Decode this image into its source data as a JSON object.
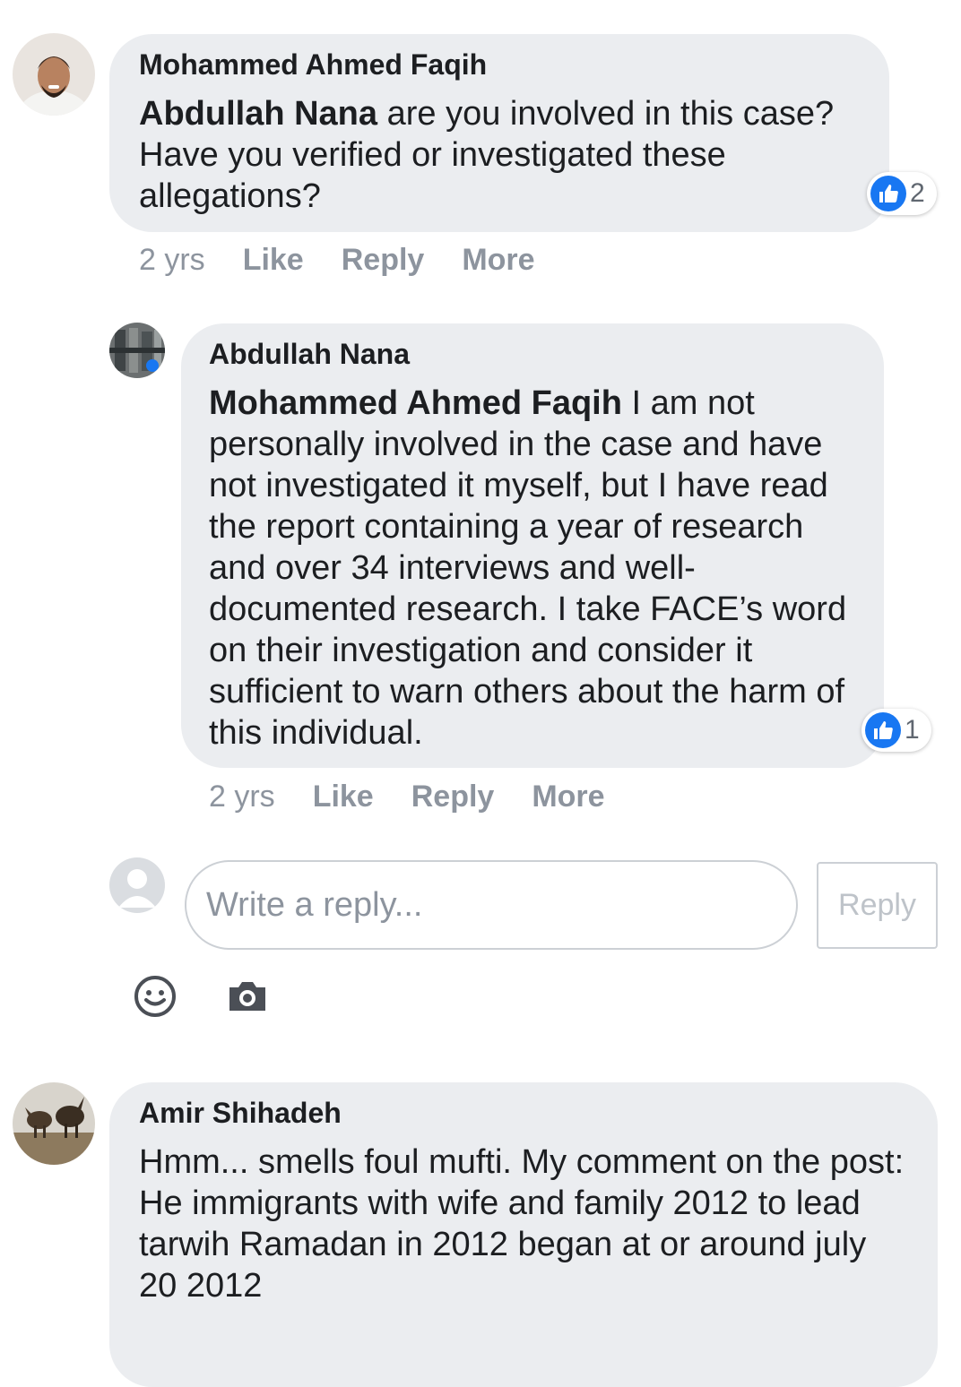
{
  "comments": [
    {
      "author": "Mohammed Ahmed Faqih",
      "mention": "Abdullah Nana",
      "text": " are you involved in this case? Have you verified or investigated these allegations?",
      "reaction_count": "2",
      "time": "2 yrs",
      "actions": [
        "Like",
        "Reply",
        "More"
      ]
    },
    {
      "author": "Abdullah Nana",
      "mention": "Mohammed Ahmed Faqih",
      "text": " I am not personally involved in the case and have not investigated it myself, but I have read the report containing a year of research and over 34 interviews and well-documented research. I take FACE’s word on their investigation and consider it sufficient to warn others about the harm of this individual.",
      "reaction_count": "1",
      "time": "2 yrs",
      "actions": [
        "Like",
        "Reply",
        "More"
      ]
    },
    {
      "author": "Amir Shihadeh",
      "text": "Hmm... smells foul mufti. My comment on the post: He immigrants with wife and family 2012 to lead tarwih Ramadan in 2012 began at or around july 20 2012"
    }
  ],
  "reply_box": {
    "placeholder": "Write a reply...",
    "button_label": "Reply"
  },
  "icons": {
    "reaction": "like-icon",
    "emoji": "smiley-icon",
    "camera": "camera-icon",
    "default_avatar": "user-silhouette-icon"
  },
  "colors": {
    "bubble": "#ebedf0",
    "like_blue": "#1877f2",
    "muted_text": "#8d949e"
  }
}
